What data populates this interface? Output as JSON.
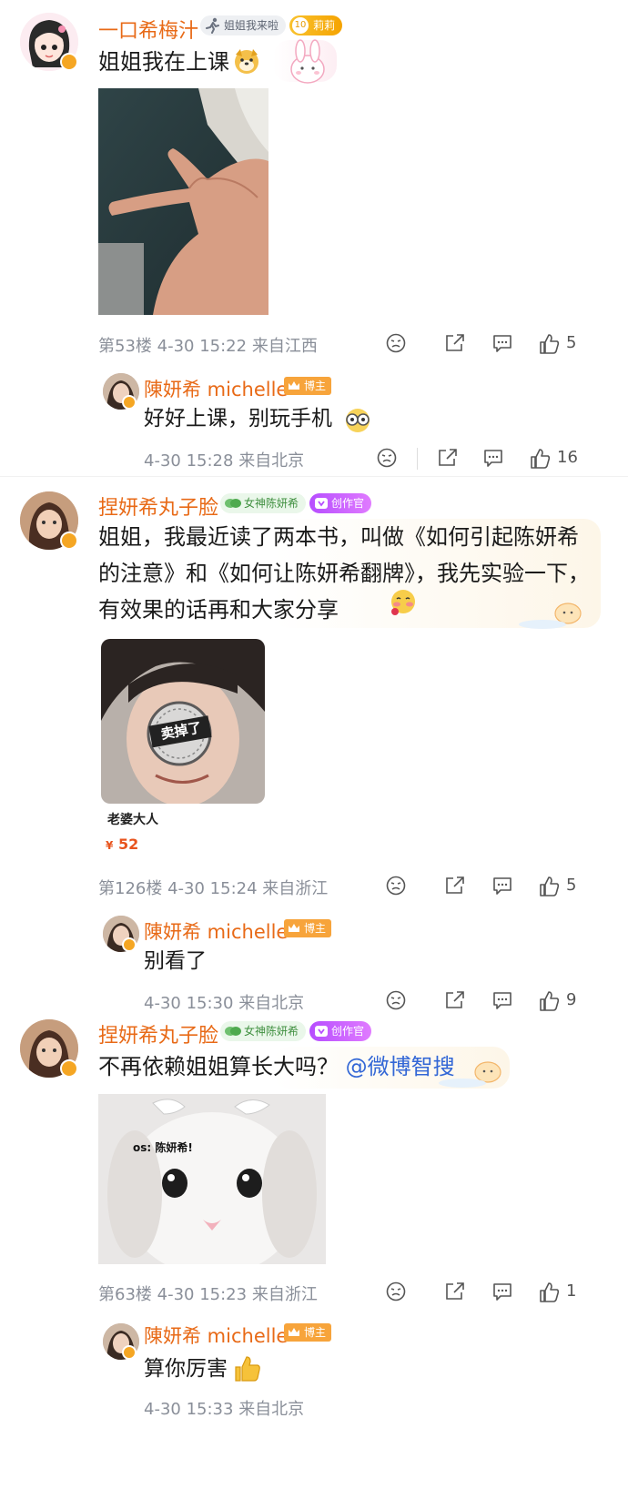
{
  "comments": [
    {
      "username": "一口希梅汁",
      "badge_label": "姐姐我来啦",
      "level_label": "莉莉",
      "level_num": "10",
      "text": "姐姐我在上课",
      "floor": "第53楼",
      "time": "4-30 15:22",
      "location": "来自江西",
      "likes": "5",
      "reply": {
        "username": "陳妍希 michelle",
        "role": "博主",
        "text": "好好上课，别玩手机",
        "time": "4-30 15:28",
        "location": "来自北京",
        "likes": "16"
      }
    },
    {
      "username": "捏妍希丸子脸",
      "fan_label": "女神陈妍希",
      "role_label": "创作官",
      "text": "姐姐，我最近读了两本书，叫做《如何引起陈妍希的注意》和《如何让陈妍希翻牌》，我先实验一下，有效果的话再和大家分享",
      "card": {
        "stamp": "卖掉了",
        "title": "老婆大人",
        "currency": "¥",
        "price": "52"
      },
      "floor": "第126楼",
      "time": "4-30 15:24",
      "location": "来自浙江",
      "likes": "5",
      "reply": {
        "username": "陳妍希 michelle",
        "role": "博主",
        "text": "别看了",
        "time": "4-30 15:30",
        "location": "来自北京",
        "likes": "9"
      }
    },
    {
      "username": "捏妍希丸子脸",
      "fan_label": "女神陈妍希",
      "role_label": "创作官",
      "text": "不再依赖姐姐算长大吗？",
      "mention": "@微博智搜",
      "image_caption": "os: 陈妍希!",
      "floor": "第63楼",
      "time": "4-30 15:23",
      "location": "来自浙江",
      "likes": "1",
      "reply": {
        "username": "陳妍希 michelle",
        "role": "博主",
        "text": "算你厉害",
        "time": "4-30 15:33",
        "location": "来自北京"
      }
    }
  ],
  "colors": {
    "username": "#e86a17",
    "meta": "#8a8f99",
    "mention": "#3367d6",
    "verified": "#f5a623",
    "price": "#e8541e"
  },
  "icons": [
    "dislike-icon",
    "share-icon",
    "comment-icon",
    "like-icon",
    "verified-icon",
    "runner-icon",
    "leaf-icon",
    "crown-icon",
    "thumbs-up-emoji",
    "dog-emoji",
    "glasses-emoji",
    "blush-emoji"
  ]
}
